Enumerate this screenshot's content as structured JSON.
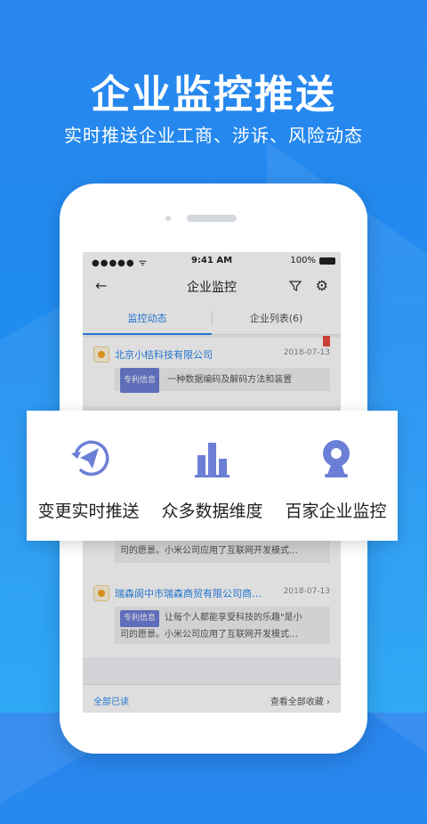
{
  "hero": {
    "title": "企业监控推送",
    "subtitle": "实时推送企业工商、涉诉、风险动态"
  },
  "status_bar": {
    "signal": "●●●●● ᯤ",
    "time": "9:41 AM",
    "battery": "100%"
  },
  "nav": {
    "back_icon": "back-arrow-icon",
    "title": "企业监控",
    "filter_icon": "filter-icon",
    "settings_icon": "gear-icon"
  },
  "tabs": [
    {
      "label": "监控动态",
      "active": true
    },
    {
      "label": "企业列表(6)",
      "active": false
    }
  ],
  "items": [
    {
      "company": "北京小桔科技有限公司",
      "date": "2018-07-13",
      "badge": "专利信息",
      "text": "一种数据编码及解码方法和装置"
    },
    {
      "company": "",
      "date": "",
      "badge": "",
      "text_line1": "司的愿景。小米公司应用了互联网开发模式…"
    },
    {
      "company": "瑞森阆中市瑞森商贸有限公司商…",
      "date": "2018-07-13",
      "badge": "专利信息",
      "text_line1": "让每个人都能享受科技的乐趣\"是小",
      "text_line2": "司的愿景。小米公司应用了互联网开发模式…"
    }
  ],
  "footer": {
    "mark_read": "全部已读",
    "view_favorites": "查看全部收藏 ›"
  },
  "features": [
    {
      "icon": "paper-plane-icon",
      "label": "变更实时推送"
    },
    {
      "icon": "bar-chart-icon",
      "label": "众多数据维度"
    },
    {
      "icon": "webcam-icon",
      "label": "百家企业监控"
    }
  ],
  "colors": {
    "accent": "#2a86ee",
    "icon": "#6c7fd6",
    "badge": "#6c7fd6"
  }
}
